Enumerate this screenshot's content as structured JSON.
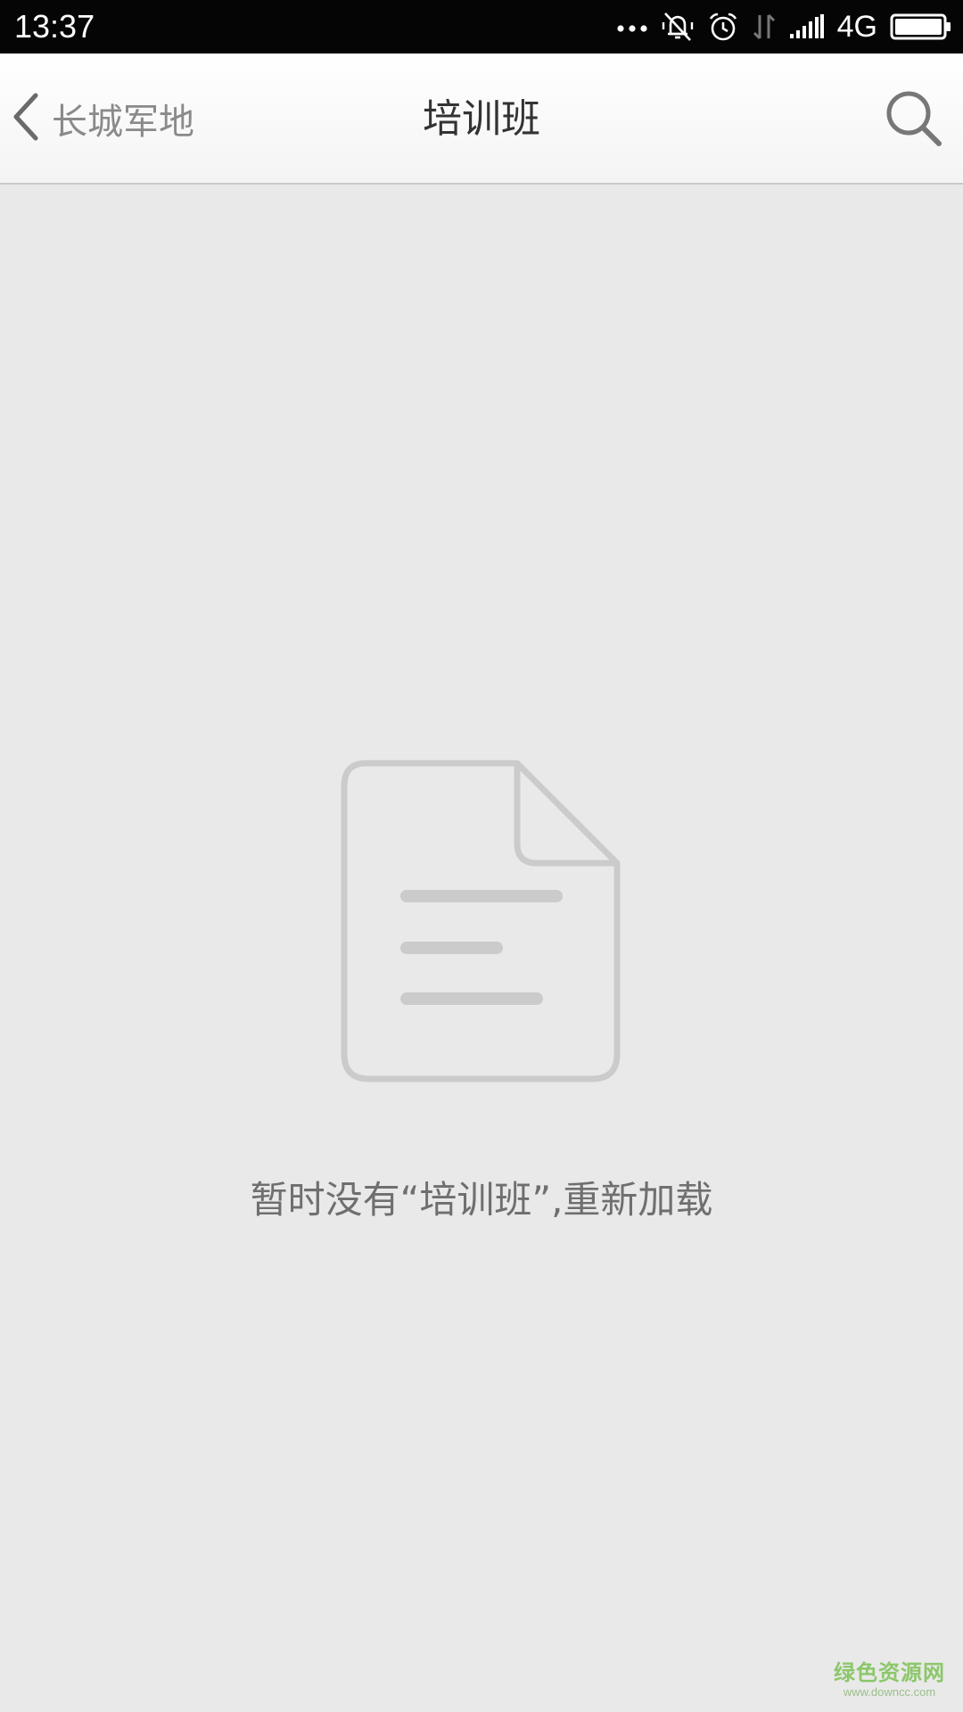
{
  "status_bar": {
    "time": "13:37",
    "network": "4G",
    "icons": [
      "more-dots-icon",
      "vibrate-off-icon",
      "alarm-icon",
      "data-transfer-icon",
      "signal-icon",
      "battery-icon"
    ]
  },
  "nav": {
    "back_label": "长城军地",
    "title": "培训班",
    "icons": [
      "back-chevron-icon",
      "search-icon"
    ]
  },
  "empty_state": {
    "icon": "document-icon",
    "message": "暂时没有“培训班”,重新加载"
  },
  "watermark": {
    "name": "绿色资源网",
    "url": "www.downcc.com"
  },
  "colors": {
    "background": "#e9e9e9",
    "status_bar": "#050505",
    "watermark": "#8cc76a"
  }
}
